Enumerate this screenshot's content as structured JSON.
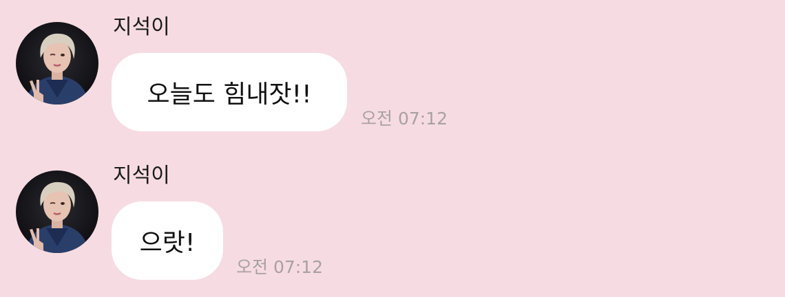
{
  "messages": [
    {
      "sender": "지석이",
      "avatar_icon": "profile-photo-icon",
      "text": "오늘도 힘내잣!!",
      "time": "오전 07:12"
    },
    {
      "sender": "지석이",
      "avatar_icon": "profile-photo-icon",
      "text": "으랏!",
      "time": "오전 07:12"
    }
  ],
  "colors": {
    "background": "#f6dce2",
    "bubble": "#ffffff",
    "timestamp": "#a8a0a3",
    "text": "#111111"
  }
}
